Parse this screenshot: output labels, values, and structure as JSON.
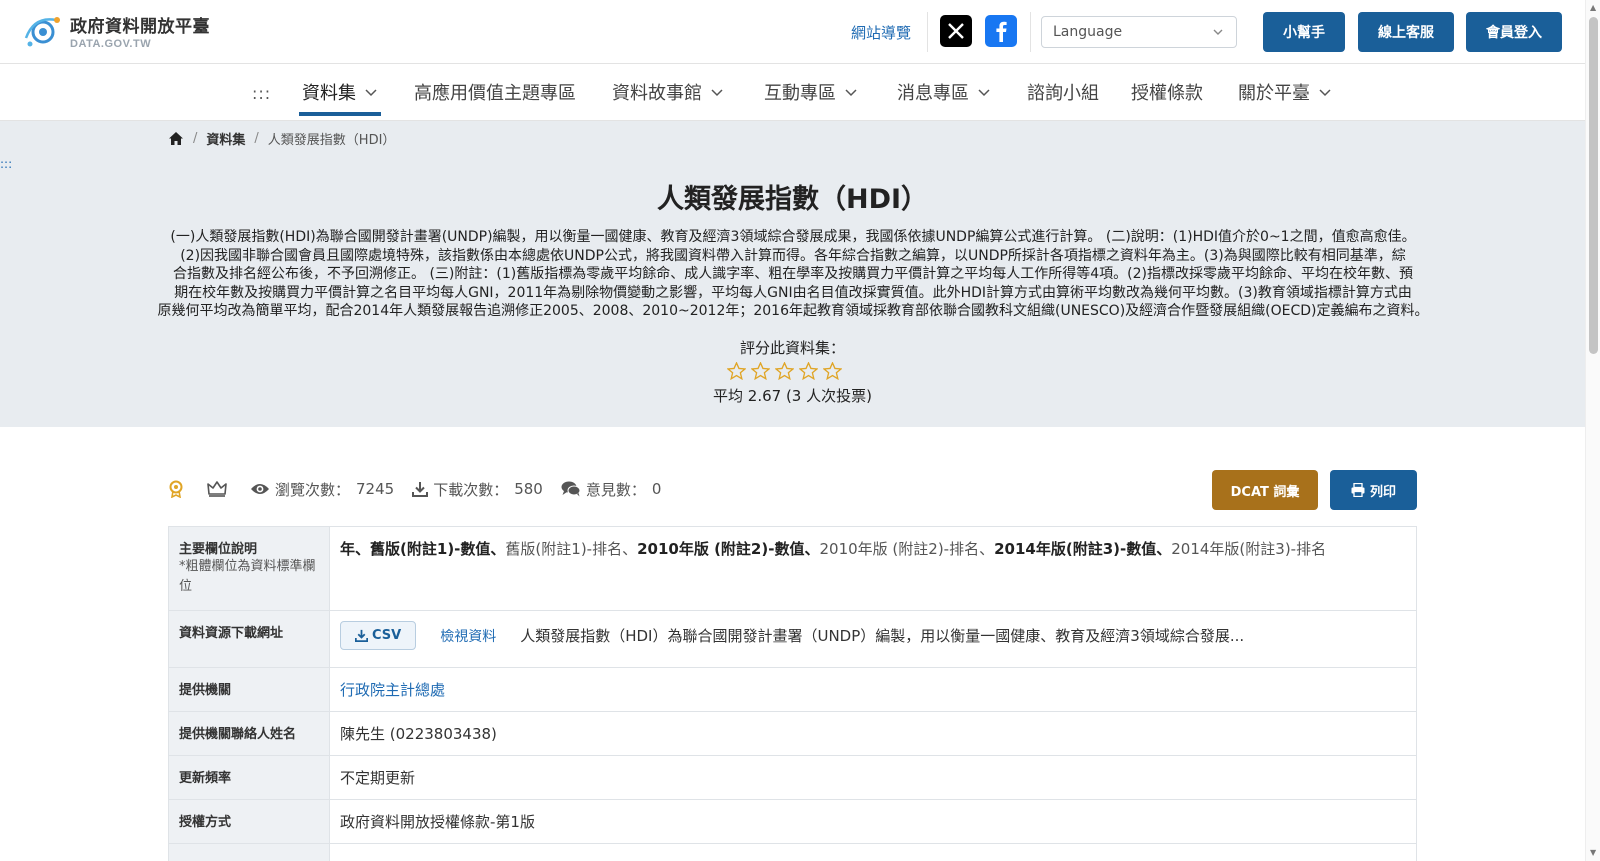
{
  "header": {
    "logo_title": "政府資料開放平臺",
    "logo_sub": "DATA.GOV.TW",
    "sitemap": "網站導覽",
    "language_placeholder": "Language",
    "helper_btn": "小幫手",
    "service_btn": "線上客服",
    "login_btn": "會員登入"
  },
  "nav": {
    "dots": ":::",
    "items": [
      "資料集",
      "高應用價值主題專區",
      "資料故事館",
      "互動專區",
      "消息專區",
      "諮詢小組",
      "授權條款",
      "關於平臺"
    ]
  },
  "breadcrumb": {
    "dataset": "資料集",
    "current": "人類發展指數（HDI）"
  },
  "side_dots": ":::",
  "hero": {
    "title": "人類發展指數（HDI）",
    "description_lines": [
      "(一)人類發展指數(HDI)為聯合國開發計畫署(UNDP)編製，用以衡量一國健康、教育及經濟3領域綜合發展成果，我國係依據UNDP編算公式進行計算。 (二)說明：(1)HDI值介於0~1之間，值愈高愈佳。",
      "(2)因我國非聯合國會員且國際處境特殊，該指數係由本總處依UNDP公式，將我國資料帶入計算而得。各年綜合指數之編算，以UNDP所採計各項指標之資料年為主。(3)為與國際比較有相同基準，綜",
      "合指數及排名經公布後，不予回溯修正。 (三)附註：(1)舊版指標為零歲平均餘命、成人識字率、粗在學率及按購買力平價計算之平均每人工作所得等4項。(2)指標改採零歲平均餘命、平均在校年數、預",
      "期在校年數及按購買力平價計算之名目平均每人GNI，2011年為剔除物價變動之影響，平均每人GNI由名目值改採實質值。此外HDI計算方式由算術平均數改為幾何平均數。(3)教育領域指標計算方式由",
      "原幾何平均改為簡單平均，配合2014年人類發展報告追溯修正2005、2008、2010~2012年；2016年起教育領域採教育部依聯合國教科文組織(UNESCO)及經濟合作暨發展組織(OECD)定義編布之資料。"
    ],
    "rate_label": "評分此資料集：",
    "rating_stars": 5,
    "rating_average_text": "平均 2.67 (3 人次投票)"
  },
  "stats": {
    "views_label": "瀏覽次數：",
    "views": "7245",
    "downloads_label": "下載次數：",
    "downloads": "580",
    "comments_label": "意見數：",
    "comments": "0"
  },
  "actions": {
    "dcat": "DCAT 詞彙",
    "print": "列印"
  },
  "info": {
    "fields_header": "主要欄位說明",
    "fields_note": "*粗體欄位為資料標準欄位",
    "fields": [
      {
        "text": "年",
        "bold": true
      },
      {
        "text": "、",
        "bold": true
      },
      {
        "text": "舊版(附註1)-數值",
        "bold": true
      },
      {
        "text": "、",
        "bold": true
      },
      {
        "text": "舊版(附註1)-排名",
        "bold": false
      },
      {
        "text": "、",
        "bold": false
      },
      {
        "text": "2010年版 (附註2)-數值",
        "bold": true
      },
      {
        "text": "、",
        "bold": true
      },
      {
        "text": "2010年版 (附註2)-排名",
        "bold": false
      },
      {
        "text": "、",
        "bold": false
      },
      {
        "text": "2014年版(附註3)-數值",
        "bold": true
      },
      {
        "text": "、",
        "bold": true
      },
      {
        "text": "2014年版(附註3)-排名",
        "bold": false
      }
    ],
    "resource_header": "資料資源下載網址",
    "csv_label": "CSV",
    "view_label": "檢視資料",
    "resource_desc": "人類發展指數（HDI）為聯合國開發計畫署（UNDP）編製，用以衡量一國健康、教育及經濟3領域綜合發展...",
    "provider_header": "提供機關",
    "provider": "行政院主計總處",
    "contact_header": "提供機關聯絡人姓名",
    "contact": "陳先生 (0223803438)",
    "frequency_header": "更新頻率",
    "frequency": "不定期更新",
    "license_header": "授權方式",
    "license": "政府資料開放授權條款-第1版"
  },
  "colors": {
    "primary": "#1a5f99",
    "dcat": "#a8711b",
    "hero_bg": "#e8ecf0",
    "star": "#e0a526"
  }
}
